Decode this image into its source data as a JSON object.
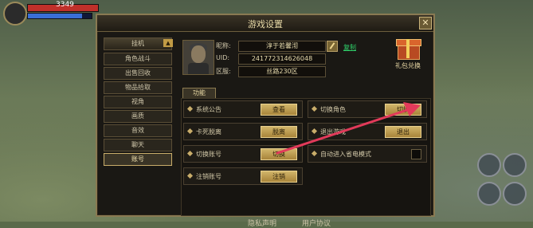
{
  "hud": {
    "hp_text": "3349"
  },
  "dialog": {
    "title": "游戏设置",
    "close_label": "✕"
  },
  "nav": {
    "items": [
      {
        "label": "挂机"
      },
      {
        "label": "角色战斗"
      },
      {
        "label": "出售回收"
      },
      {
        "label": "物品拾取"
      },
      {
        "label": "视角"
      },
      {
        "label": "画质"
      },
      {
        "label": "音效"
      },
      {
        "label": "聊天"
      },
      {
        "label": "账号"
      }
    ],
    "active": "账号"
  },
  "profile": {
    "nickname_label": "昵称:",
    "nickname": "淳于若馨沏",
    "uid_label": "UID:",
    "uid": "241772314626048",
    "server_label": "区服:",
    "server": "丝路230区",
    "copy_label": "复制",
    "gift_label": "礼包兑换"
  },
  "section_tab": "功能",
  "options": [
    {
      "label": "系统公告",
      "button": "查看"
    },
    {
      "label": "切换角色",
      "button": "切换"
    },
    {
      "label": "卡死脱离",
      "button": "脱离"
    },
    {
      "label": "退出游戏",
      "button": "退出"
    },
    {
      "label": "切换账号",
      "button": "切换"
    },
    {
      "label": "自动进入省电模式",
      "button": ""
    },
    {
      "label": "注销账号",
      "button": "注销"
    }
  ],
  "footer": {
    "privacy": "隐私声明",
    "agreement": "用户协议"
  },
  "colors": {
    "annotation_arrow": "#e23a5a",
    "accent_gold": "#c9ad6a"
  }
}
